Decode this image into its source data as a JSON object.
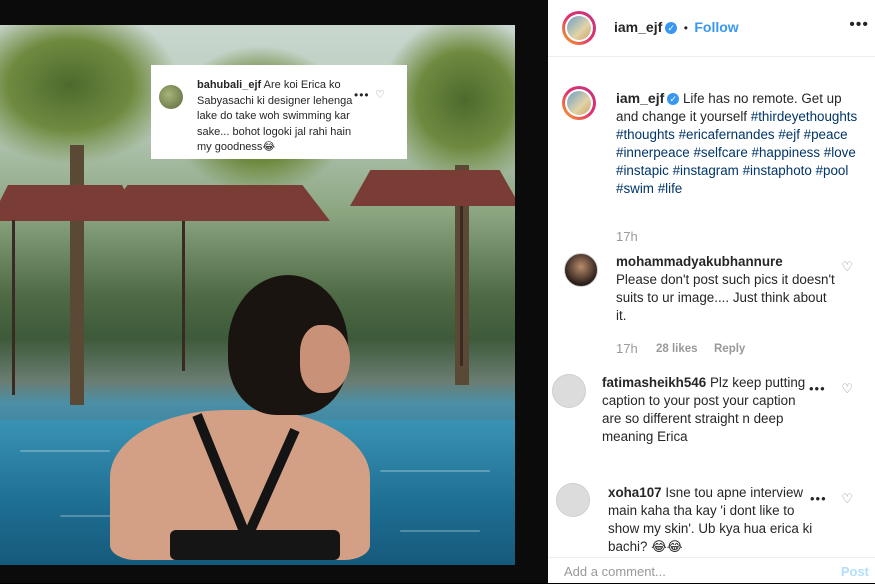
{
  "post": {
    "username": "iam_ejf",
    "verified_mark": "✓",
    "follow_separator": "•",
    "follow_label": "Follow",
    "more_label": "•••",
    "caption_text": "Life has no remote. Get up and change it yourself",
    "hashtags": [
      "#thirdeyethoughts",
      "#thoughts",
      "#ericafernandes",
      "#ejf",
      "#peace",
      "#innerpeace",
      "#selfcare",
      "#happiness",
      "#love",
      "#instapic",
      "#instagram",
      "#instaphoto",
      "#pool",
      "#swim",
      "#life"
    ],
    "time": "17h"
  },
  "overlay_comment": {
    "username": "bahubali_ejf",
    "text": "Are koi Erica ko Sabyasachi ki designer lehenga lake do take woh swimming kar sake... bohot logoki jal rahi hain my goodness😂",
    "dots": "•••",
    "heart": "♡"
  },
  "comments": [
    {
      "username": "mohammadyakubhannure",
      "text": "Please don't post such pics it doesn't suits to ur image.... Just think about it.",
      "time": "17h",
      "likes": "28 likes",
      "reply": "Reply",
      "heart": "♡"
    },
    {
      "username": "fatimasheikh546",
      "text": "Plz keep putting caption to your post your caption are so different straight n deep meaning Erica",
      "dots": "•••",
      "heart": "♡"
    },
    {
      "username": "xoha107",
      "text": "Isne tou apne interview main kaha tha kay 'i dont like to show my skin'. Ub kya hua erica ki bachi? 😂😂",
      "dots": "•••",
      "heart": "♡"
    }
  ],
  "add_comment": {
    "placeholder": "Add a comment...",
    "post_label": "Post"
  },
  "icons": {
    "verified": "verified-badge-icon",
    "heart": "heart-icon",
    "more": "more-options-icon"
  },
  "colors": {
    "link": "#3897f0",
    "hashtag": "#003569",
    "muted": "#999999"
  }
}
